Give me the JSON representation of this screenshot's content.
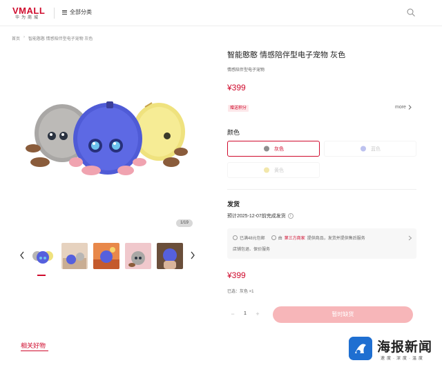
{
  "header": {
    "logo_main": "VMALL",
    "logo_sub": "华为商城",
    "category_label": "全部分类"
  },
  "breadcrumb": {
    "home": "首页",
    "current": "智能憨憨 情感陪伴型电子宠物 灰色"
  },
  "gallery": {
    "page_indicator": "1/19",
    "thumbnails": [
      {
        "name": "plush-trio",
        "bg": "#ffffff"
      },
      {
        "name": "plush-scene",
        "bg": "#e6d2bf"
      },
      {
        "name": "plush-sunset",
        "bg": "#e8884a"
      },
      {
        "name": "plush-pink",
        "bg": "#f0c8cc"
      },
      {
        "name": "plush-hand",
        "bg": "#6a4e3a"
      }
    ]
  },
  "product": {
    "title": "智能憨憨 情感陪伴型电子宠物 灰色",
    "subtitle": "情感陪伴型电子宠物",
    "price": "¥399",
    "points_tag": "赠送积分",
    "more_label": "more",
    "color_label": "颜色",
    "colors": [
      {
        "label": "灰色",
        "state": "selected",
        "swatch": "#8e8e8e"
      },
      {
        "label": "蓝色",
        "state": "disabled",
        "swatch": "#5a66d8"
      },
      {
        "label": "黄色",
        "state": "disabled",
        "swatch": "#e6cf57"
      }
    ],
    "shipping_label": "发货",
    "shipping_date": "预计2025-12-07前完成发货",
    "services": {
      "line1_a": "已满48元包邮",
      "line1_b_pre": "由",
      "line1_b_hl": "第三方商家",
      "line1_b_post": "提供商品，发货并提供售后服务",
      "line2": "店铺包退、保价服务"
    },
    "bottom_price": "¥399",
    "selected_text": "已选：灰色 ×1",
    "quantity": "1",
    "minus": "−",
    "plus": "+",
    "buy_label": "暂时缺货"
  },
  "related": {
    "label": "相关好物"
  },
  "watermark": {
    "title": "海报新闻",
    "sub": "速度·深度·温度"
  },
  "colors": {
    "brand": "#cf0a2c",
    "buy_disabled": "#f7b6b9"
  }
}
